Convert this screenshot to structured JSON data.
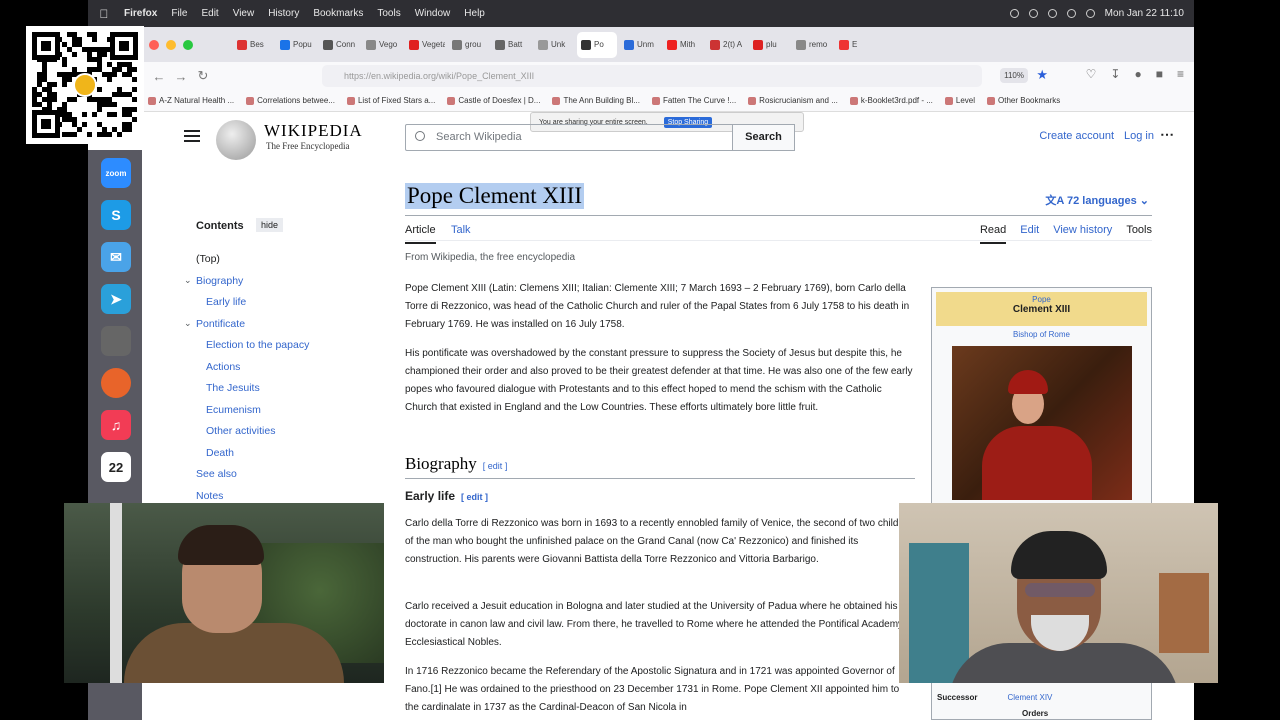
{
  "menubar": {
    "items": [
      "Firefox",
      "File",
      "Edit",
      "View",
      "History",
      "Bookmarks",
      "Tools",
      "Window",
      "Help"
    ],
    "clock": "Mon Jan 22  11:10"
  },
  "browser": {
    "active_tab": "Po",
    "tabs": [
      "Bes",
      "Popu",
      "Conn",
      "Vego",
      "Vegeta",
      "grou",
      "Batt",
      "Unk",
      "Po",
      "Unm",
      "Mith",
      "2(t) A",
      "plu",
      "remo",
      "E"
    ],
    "url": "https://en.wikipedia.org/wiki/Pope_Clement_XIII",
    "zoom": "110%",
    "bookmarks": [
      "A-Z Natural Health ...",
      "Correlations betwee...",
      "List of Fixed Stars a...",
      "Castle of Doesfex | D...",
      "The Ann Building Bl...",
      "Fatten The Curve !...",
      "Rosicrucianism and ...",
      "k-Booklet3rd.pdf - ...",
      "Level",
      "Other Bookmarks"
    ]
  },
  "share": {
    "message": "You are sharing your entire screen.",
    "stop_label": "Stop Sharing"
  },
  "wiki": {
    "logo_title": "WIKIPEDIA",
    "logo_sub": "The Free Encyclopedia",
    "search_placeholder": "Search Wikipedia",
    "search_button": "Search",
    "create_account": "Create account",
    "login": "Log in",
    "title": "Pope Clement XIII",
    "languages": "72 languages",
    "tab_article": "Article",
    "tab_talk": "Talk",
    "tab_read": "Read",
    "tab_edit": "Edit",
    "tab_history": "View history",
    "tab_tools": "Tools",
    "tagline": "From Wikipedia, the free encyclopedia",
    "toc": {
      "header": "Contents",
      "hide": "hide",
      "items": [
        "(Top)",
        "Biography",
        "Early life",
        "Pontificate",
        "Election to the papacy",
        "Actions",
        "The Jesuits",
        "Ecumenism",
        "Other activities",
        "Death",
        "See also",
        "Notes"
      ]
    },
    "intro1": "Pope Clement XIII (Latin: Clemens XIII; Italian: Clemente XIII; 7 March 1693 – 2 February 1769), born Carlo della Torre di Rezzonico, was head of the Catholic Church and ruler of the Papal States from 6 July 1758 to his death in February 1769. He was installed on 16 July 1758.",
    "intro2": "His pontificate was overshadowed by the constant pressure to suppress the Society of Jesus but despite this, he championed their order and also proved to be their greatest defender at that time. He was also one of the few early popes who favoured dialogue with Protestants and to this effect hoped to mend the schism with the Catholic Church that existed in England and the Low Countries. These efforts ultimately bore little fruit.",
    "h2_biography": "Biography",
    "edit_label": "edit",
    "h3_early": "Early life",
    "early1": "Carlo della Torre di Rezzonico was born in 1693 to a recently ennobled family of Venice, the second of two children of the man who bought the unfinished palace on the Grand Canal (now Ca' Rezzonico) and finished its construction. His parents were Giovanni Battista della Torre Rezzonico and Vittoria Barbarigo.",
    "early2": "Carlo received a Jesuit education in Bologna and later studied at the University of Padua where he obtained his doctorate in canon law and civil law. From there, he travelled to Rome where he attended the Pontifical Academy of Ecclesiastical Nobles.",
    "early3": "In 1716 Rezzonico became the Referendary of the Apostolic Signatura and in 1721 was appointed Governor of Fano.[1] He was ordained to the priesthood on 23 December 1731 in Rome. Pope Clement XII appointed him to the cardinalate in 1737 as the Cardinal-Deacon of San Nicola in",
    "infobox": {
      "pre": "Pope",
      "name": "Clement XIII",
      "sub": "Bishop of Rome",
      "successor_label": "Successor",
      "successor": "Clement XIV",
      "orders": "Orders"
    }
  },
  "dock": {
    "calendar_day": "22"
  }
}
